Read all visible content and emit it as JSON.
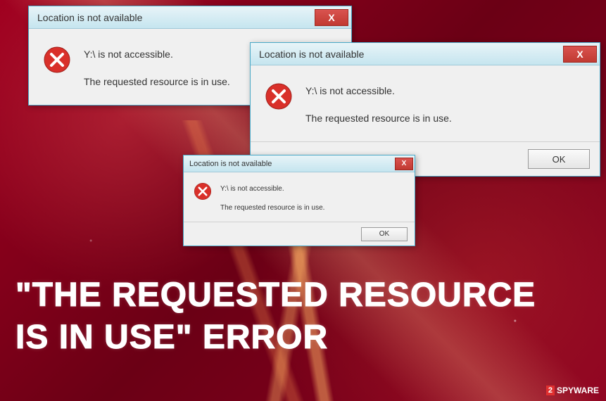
{
  "dialogs": [
    {
      "title": "Location is not available",
      "line1": "Y:\\ is not accessible.",
      "line2": "The requested resource is in use.",
      "close": "X"
    },
    {
      "title": "Location is not available",
      "line1": "Y:\\ is not accessible.",
      "line2": "The requested resource is in use.",
      "close": "X",
      "ok": "OK"
    },
    {
      "title": "Location is not available",
      "line1": "Y:\\ is not accessible.",
      "line2": "The requested resource is in use.",
      "close": "X",
      "ok": "OK"
    }
  ],
  "headline": {
    "line1": "\"THE REQUESTED RESOURCE",
    "line2": "IS IN USE\" ERROR"
  },
  "watermark": {
    "num": "2",
    "text": "SPYWARE"
  }
}
